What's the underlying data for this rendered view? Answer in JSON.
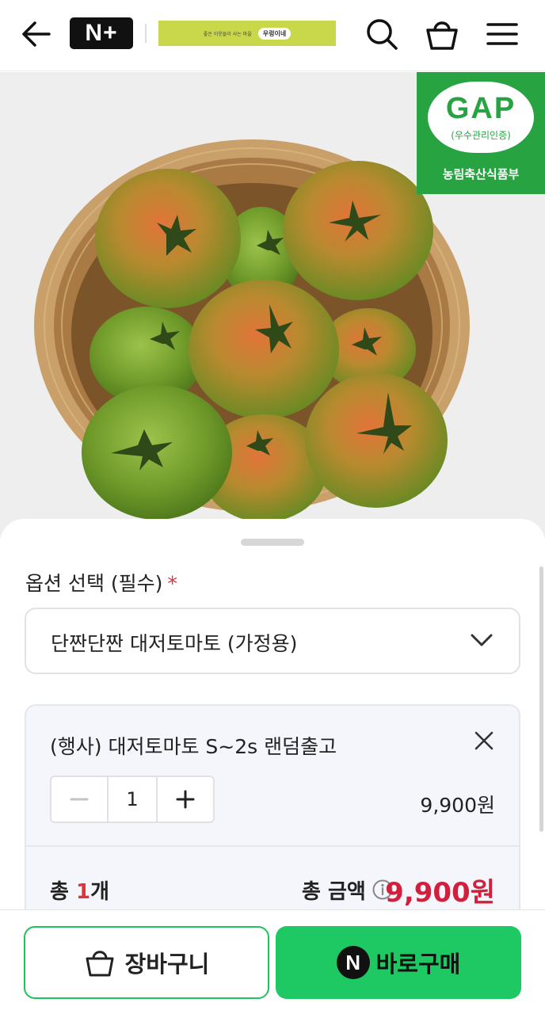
{
  "header": {
    "logo_text": "N+",
    "banner": {
      "left_text": "좋은 이웃들이 사는 마을",
      "logo_text": "우렁이네"
    },
    "icons": [
      "back-arrow-icon",
      "search-icon",
      "shopping-bag-icon",
      "menu-icon"
    ]
  },
  "product": {
    "badge": {
      "title": "GAP",
      "subtitle": "(우수관리인증)",
      "ministry": "농림축산식품부"
    },
    "accent_colors": {
      "badge_green": "#27a342",
      "basket": "#c9a06a",
      "tomato_green": "#6f9a2a",
      "tomato_red": "#d9622a"
    }
  },
  "options": {
    "label": "옵션 선택 (필수)",
    "required_mark": "*",
    "selected": "단짠단짠 대저토마토 (가정용)"
  },
  "item": {
    "name": "(행사) 대저토마토 S~2s 랜덤출고",
    "quantity": "1",
    "price": "9,900원"
  },
  "totals": {
    "count_prefix": "총 ",
    "count": "1",
    "count_suffix": "개",
    "amount_label": "총 금액",
    "amount": "9,900원",
    "amount_color": "#d41f3c"
  },
  "footer": {
    "cart_label": "장바구니",
    "buy_label": "바로구매",
    "buy_logo": "N",
    "accent": "#1ec863"
  }
}
